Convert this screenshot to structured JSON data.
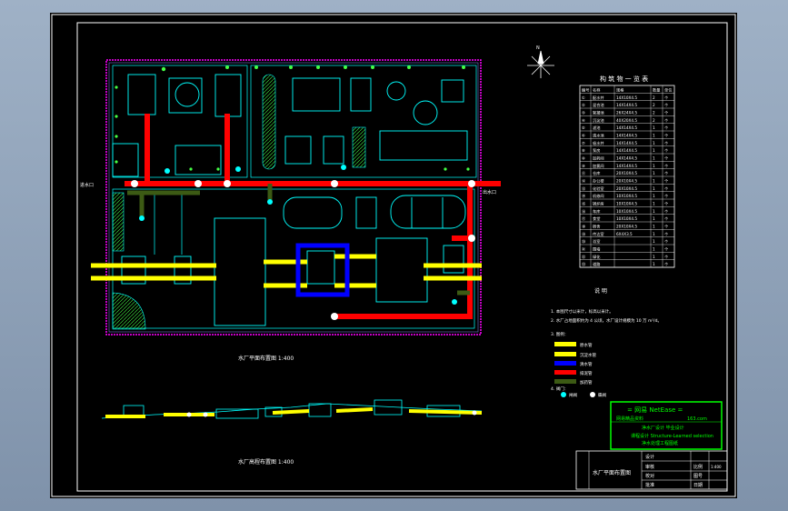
{
  "drawing": {
    "plan_caption": "水厂平面布置图 1:400",
    "profile_caption": "水厂高程布置图 1:400",
    "table_title": "构 筑 物 一 览 表",
    "north_label": "N",
    "inlet_label": "进水口",
    "outlet_label": "出水口"
  },
  "table": {
    "headers": [
      "编号",
      "名称",
      "规格",
      "数量",
      "单位"
    ],
    "rows": [
      [
        "①",
        "配水井",
        "14X10X4.5",
        "2",
        "个"
      ],
      [
        "②",
        "混合池",
        "14X14X4.5",
        "2",
        "个"
      ],
      [
        "③",
        "絮凝池",
        "26X24X4.5",
        "2",
        "个"
      ],
      [
        "④",
        "沉淀池",
        "40X20X4.5",
        "2",
        "个"
      ],
      [
        "⑤",
        "滤池",
        "14X14X4.5",
        "1",
        "个"
      ],
      [
        "⑥",
        "清水池",
        "14X14X4.5",
        "1",
        "个"
      ],
      [
        "⑦",
        "吸水井",
        "14X14X4.5",
        "1",
        "个"
      ],
      [
        "⑧",
        "泵房",
        "14X14X4.5",
        "1",
        "个"
      ],
      [
        "⑨",
        "加药间",
        "14X14X4.5",
        "1",
        "个"
      ],
      [
        "⑩",
        "加氯间",
        "14X14X4.5",
        "1",
        "个"
      ],
      [
        "⑪",
        "仓库",
        "20X10X4.5",
        "1",
        "个"
      ],
      [
        "⑫",
        "办公楼",
        "20X10X4.5",
        "1",
        "个"
      ],
      [
        "⑬",
        "化验室",
        "20X10X4.5",
        "1",
        "个"
      ],
      [
        "⑭",
        "机修间",
        "10X10X4.5",
        "1",
        "个"
      ],
      [
        "⑮",
        "锅炉房",
        "10X10X4.5",
        "1",
        "个"
      ],
      [
        "⑯",
        "车库",
        "10X10X4.5",
        "1",
        "个"
      ],
      [
        "⑰",
        "食堂",
        "10X10X4.5",
        "1",
        "个"
      ],
      [
        "⑱",
        "宿舍",
        "20X10X4.5",
        "1",
        "个"
      ],
      [
        "⑲",
        "传达室",
        "6X4X3.5",
        "1",
        "个"
      ],
      [
        "⑳",
        "浴室",
        "",
        "1",
        "个"
      ],
      [
        "㉑",
        "围墙",
        "",
        "1",
        "个"
      ],
      [
        "㉒",
        "绿化",
        "",
        "1",
        "个"
      ],
      [
        "㉓",
        "道路",
        "",
        "1",
        "个"
      ]
    ]
  },
  "notes": {
    "title": "说 明",
    "lines": [
      "1. 本图尺寸以米计，标高以米计。",
      "2. 水厂占地面积约为 4 公顷，水厂设计规模为 10 万 m³/d。",
      "3. 图例："
    ],
    "legend": [
      {
        "label": "原水管",
        "color": "#ffff00"
      },
      {
        "label": "沉淀水管",
        "color": "#ffff00"
      },
      {
        "label": "清水管",
        "color": "#0000ff"
      },
      {
        "label": "排泥管",
        "color": "#ff0000"
      },
      {
        "label": "加药管",
        "color": "#3c5a14"
      }
    ],
    "valve_title": "4. 阀门：",
    "valve_labels": [
      "闸阀",
      "蝶阀"
    ]
  },
  "title_block": {
    "brand": "= 网易 NetEase =",
    "brand_sub": "网易精品资料",
    "site": "163.com",
    "line1": "净水厂设计 毕业设计",
    "line2": "课程设计 Structure-Learned selection",
    "line3": "净水处理工程图纸",
    "drawing_name": "水厂平面布置图",
    "rows": [
      "设计",
      "审核",
      "校对",
      "批准"
    ],
    "fields": [
      "比例",
      "图号",
      "日期"
    ],
    "scale": "1:400"
  },
  "colors": {
    "background": "#000000",
    "frame": "#ffffff",
    "building": "#00ffff",
    "wall": "#ff00ff",
    "pipe_red": "#ff0000",
    "pipe_yellow": "#ffff00",
    "pipe_blue": "#0000ff",
    "pipe_green": "#3c5a14",
    "tree": "#44ff44",
    "title_border": "#00ff00"
  }
}
